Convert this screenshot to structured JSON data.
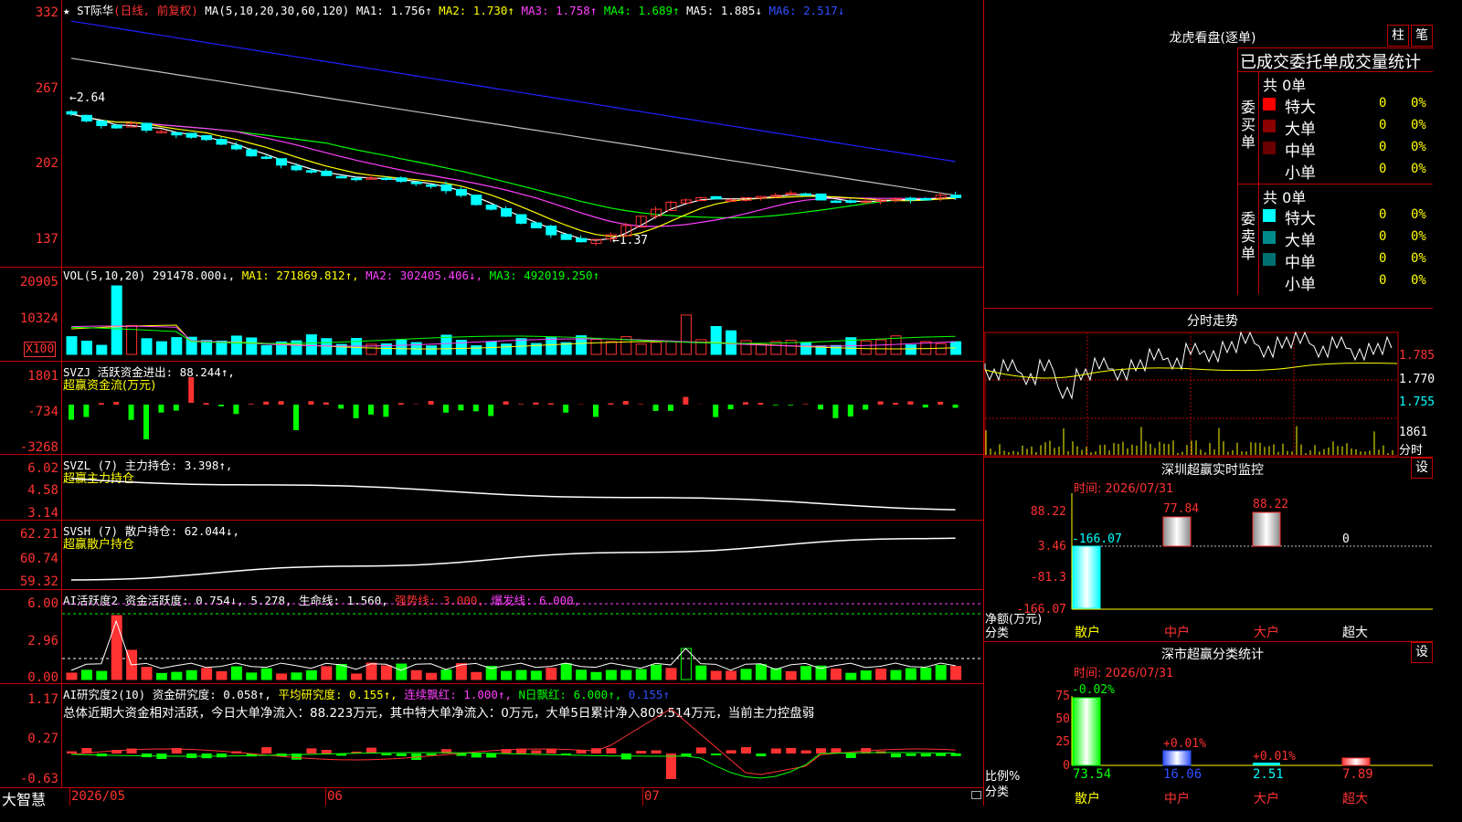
{
  "header": {
    "star_mark": "★",
    "stock_name": "ST际华",
    "mode": "(日线, 前复权)",
    "ma_label": "MA(5,10,20,30,60,120)",
    "ma1": "MA1: 1.756↑",
    "ma2": "MA2: 1.730↑",
    "ma3": "MA3: 1.758↑",
    "ma4": "MA4: 1.689↑",
    "ma5": "MA5: 1.885↓",
    "ma6": "MA6: 2.517↓"
  },
  "price_panel": {
    "ticks": [
      "332",
      "267",
      "202",
      "137"
    ],
    "high_label": "←2.64",
    "low_label": "←1.37"
  },
  "vol_panel": {
    "header_main": "VOL(5,10,20) 291478.000↓,",
    "header_ma1": "MA1: 271869.812↑,",
    "header_ma2": "MA2: 302405.406↓,",
    "header_ma3": "MA3: 492019.250↑",
    "ticks": [
      "20905",
      "10324"
    ],
    "multiplier": "X100"
  },
  "svzj_panel": {
    "header": "SVZJ  活跃资金进出: 88.244↑,",
    "subtitle": "超赢资金流(万元)",
    "ticks": [
      "1801",
      "-734",
      "-3268"
    ]
  },
  "svzl_panel": {
    "header": "SVZL (7) 主力持仓: 3.398↑,",
    "subtitle": "超赢主力持仓",
    "ticks": [
      "6.02",
      "4.58",
      "3.14"
    ]
  },
  "svsh_panel": {
    "header": "SVSH (7) 散户持仓: 62.044↓,",
    "subtitle": "超赢散户持仓",
    "ticks": [
      "62.21",
      "60.74",
      "59.32"
    ]
  },
  "ai_active_panel": {
    "header_a": "AI活跃度2 资金活跃度: 0.754↓, 5.278, 生命线: 1.560,",
    "header_b": "强势线: 3.000,",
    "header_c": "爆发线: 6.000,",
    "ticks": [
      "6.00",
      "2.96",
      "0.00"
    ]
  },
  "ai_research_panel": {
    "header_a": "AI研究度2(10) 资金研究度: 0.058↑,",
    "header_b": "平均研究度: 0.155↑,",
    "header_c": "连续飘红: 1.000↑,",
    "header_d": "N日飘红: 6.000↑,",
    "header_e": "0.155↑",
    "summary": "总体近期大资金相对活跃，今日大单净流入：88.223万元，其中特大单净流入：0万元，大单5日累计净入809.514万元，当前主力控盘弱",
    "ticks": [
      "1.17",
      "0.27",
      "-0.63"
    ]
  },
  "x_axis": {
    "labels": [
      "2026/05",
      "06",
      "07"
    ],
    "brand": "大智慧"
  },
  "right_panel": {
    "dragon_title": "龙虎看盘(逐单)",
    "btn_zhu": "柱",
    "btn_bi": "笔",
    "stats_title": "已成交委托单成交量统计",
    "buy_group": "委买单",
    "sell_group": "委卖单",
    "buy_total": "共 0单",
    "sell_total": "共 0单",
    "buy_rows": [
      {
        "label": "特大",
        "count": "0",
        "pct": "0%",
        "color": "#ff0000"
      },
      {
        "label": "大单",
        "count": "0",
        "pct": "0%",
        "color": "#8b0000"
      },
      {
        "label": "中单",
        "count": "0",
        "pct": "0%",
        "color": "#6b0000"
      },
      {
        "label": "小单",
        "count": "0",
        "pct": "0%",
        "color": "#000000"
      }
    ],
    "sell_rows": [
      {
        "label": "特大",
        "count": "0",
        "pct": "0%",
        "color": "#00ffff"
      },
      {
        "label": "大单",
        "count": "0",
        "pct": "0%",
        "color": "#008b8b"
      },
      {
        "label": "中单",
        "count": "0",
        "pct": "0%",
        "color": "#007070"
      },
      {
        "label": "小单",
        "count": "0",
        "pct": "0%",
        "color": "#000000"
      }
    ],
    "intraday_title": "分时走势",
    "intraday_ticks": [
      "1.785",
      "1.770",
      "1.755"
    ],
    "intraday_vol": "1861",
    "intraday_vol_label": "分时",
    "monitor_title": "深圳超赢实时监控",
    "monitor_set": "设",
    "monitor_time": "时间: 2026/07/31",
    "monitor_ticks": [
      "88.22",
      "3.46",
      "-81.3",
      "-166.07"
    ],
    "monitor_bar_labels": [
      "-166.07",
      "77.84",
      "88.22",
      "0"
    ],
    "monitor_ylabel": "净额(万元)",
    "monitor_xlabel": "分类",
    "categories": [
      "散户",
      "中户",
      "大户",
      "超大"
    ],
    "class_title": "深市超赢分类统计",
    "class_set": "设",
    "class_time": "时间: 2026/07/31",
    "class_ticks": [
      "75",
      "50",
      "25",
      "0"
    ],
    "class_top_labels": [
      "-0.02%",
      "+0.01%",
      "+0.01%"
    ],
    "class_bottom_values": [
      "73.54",
      "16.06",
      "2.51",
      "7.89"
    ],
    "class_ylabel": "比例%",
    "class_xlabel": "分类"
  },
  "colors": {
    "up": "#ff3232",
    "down": "#00ffff",
    "grid": "#c00000",
    "ma_white": "#ffffff",
    "ma_yellow": "#ffff00",
    "ma_magenta": "#ff40ff",
    "ma_green": "#00ff00",
    "ma_gray": "#c0c0c0",
    "ma_blue": "#2020ff"
  }
}
